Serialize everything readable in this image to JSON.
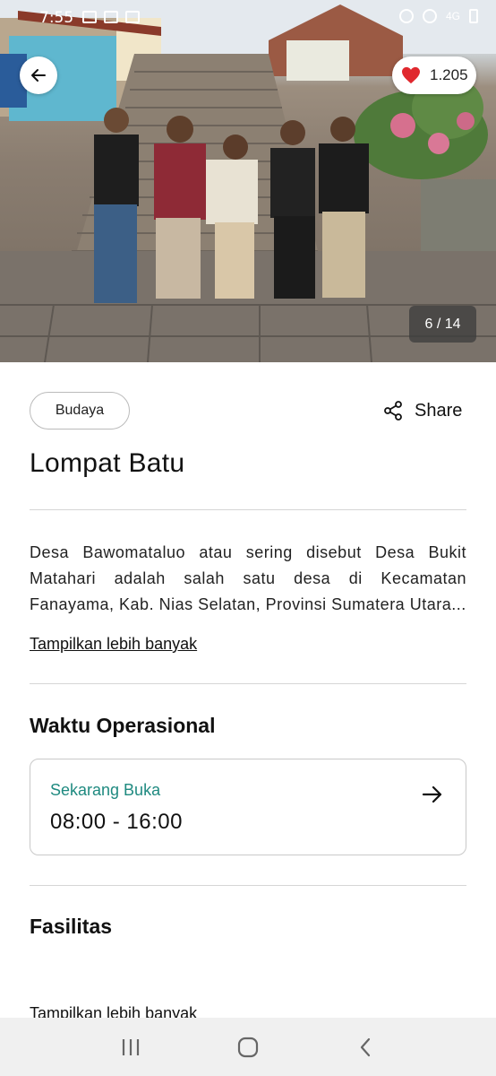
{
  "status_bar": {
    "time": "7:55",
    "network": "4G"
  },
  "hero": {
    "likes": "1.205",
    "image_counter": "6 / 14"
  },
  "place": {
    "category": "Budaya",
    "share_label": "Share",
    "title": "Lompat Batu",
    "description": "Desa Bawomataluo atau sering disebut Desa Bukit Matahari adalah salah satu desa di Kecamatan Fanayama, Kab. Nias Selatan, Provinsi Sumatera Utara...",
    "show_more": "Tampilkan lebih banyak"
  },
  "operational": {
    "section_title": "Waktu Operasional",
    "status": "Sekarang Buka",
    "hours": "08:00 - 16:00"
  },
  "facilities": {
    "section_title": "Fasilitas",
    "show_more": "Tampilkan lebih banyak"
  },
  "colors": {
    "accent": "#1f8a80",
    "heart": "#e0282e"
  },
  "icons": [
    "arrow-left-icon",
    "heart-icon",
    "share-icon",
    "arrow-right-icon",
    "recent-apps-icon",
    "home-icon",
    "back-nav-icon"
  ]
}
